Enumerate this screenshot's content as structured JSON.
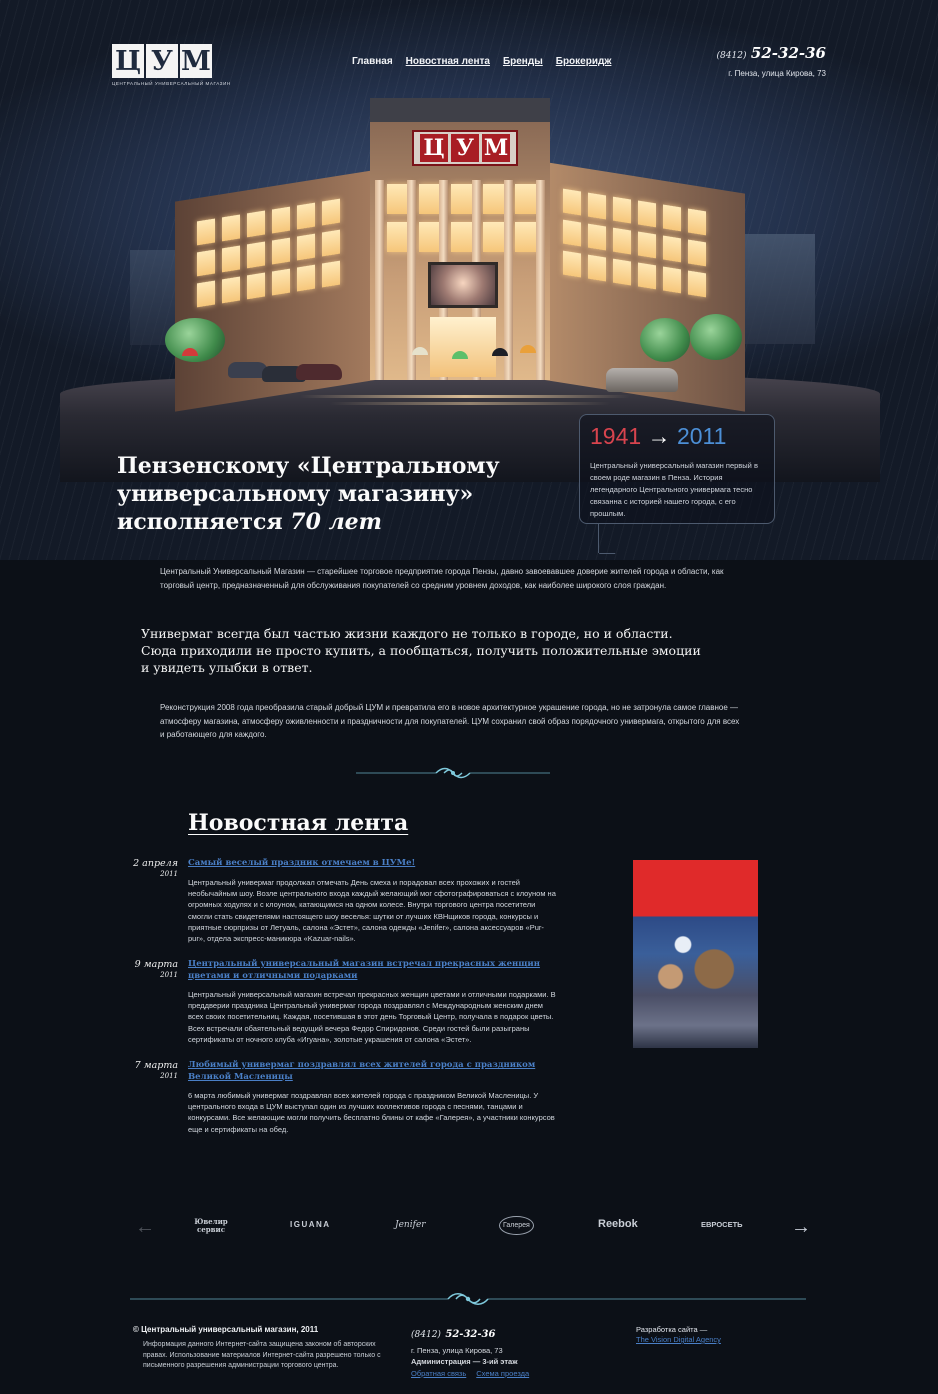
{
  "header": {
    "logo_letters": [
      "Ц",
      "У",
      "М"
    ],
    "logo_subtitle": "ЦЕНТРАЛЬНЫЙ УНИВЕРСАЛЬНЫЙ МАГАЗИН",
    "nav": [
      {
        "label": "Главная",
        "active": true
      },
      {
        "label": "Новостная лента",
        "active": false
      },
      {
        "label": "Бренды",
        "active": false
      },
      {
        "label": "Брокеридж",
        "active": false
      }
    ],
    "phone_code": "(8412)",
    "phone_number": "52-32-36",
    "address": "г. Пенза, улица Кирова, 73"
  },
  "hero": {
    "sign_letters": [
      "Ц",
      "У",
      "М"
    ]
  },
  "intro": {
    "title_text": "Пензенскому «Центральному универсальному магазину» исполняется ",
    "title_age": "70 лет",
    "year_from": "1941",
    "arrow": "→",
    "year_to": "2011",
    "bubble_text": "Центральный универсальный магазин первый в своем роде магазин в Пенза. История легендарного Центрального универмага тесно связанна с историей нашего города, с его прошлым.",
    "paragraph1": "Центральный Универсальный Магазин — старейшее торговое предприятие города Пензы, давно завоевавшее доверие жителей города и области, как торговый центр, предназначенный для обслуживания покупателей со средним уровнем доходов, как наиболее широкого слоя граждан.",
    "quote": "Универмаг всегда был частью жизни каждого не только в городе, но и области. Сюда приходили не просто купить, а пообщаться, получить положительные эмоции и увидеть улыбки в ответ.",
    "paragraph2": "Реконструкция 2008 года преобразила старый добрый ЦУМ и превратила его в новое архитектурное украшение города, но не затронула самое главное — атмосферу магазина, атмосферу оживленности и праздничности для покупателей. ЦУМ сохранил свой образ порядочного универмага, открытого для всех и работающего для каждого."
  },
  "news": {
    "title": "Новостная лента",
    "items": [
      {
        "date": "2 апреля",
        "year": "2011",
        "headline": "Самый веселый праздник отмечаем в ЦУМе!",
        "body": "Центральный универмаг продолжал отмечать День смеха и порадовал всех прохожих и гостей необычайным шоу. Возле центрального входа каждый желающий мог сфотографироваться с клоуном на огромных ходулях и с клоуном, катающимся на одном колесе. Внутри торгового центра посетители смогли стать свидетелями настоящего шоу веселья: шутки от лучших КВНщиков города, конкурсы и приятные сюрпризы от Летуаль, салона «Эстет», салона одежды «Jenifer», салона аксессуаров «Pur-pur», отдела экспресс-маникюра «Kazuar-nails»."
      },
      {
        "date": "9 марта",
        "year": "2011",
        "headline": "Центральный универсальный магазин встречал прекрасных женщин цветами и отличными подарками",
        "body": "Центральный универсальный магазин встречал прекрасных женщин цветами и отличными подарками. В преддверии праздника Центральный универмаг города поздравлял с Международным женским днем всех своих посетительниц. Каждая, посетившая в этот день Торговый Центр, получала в подарок цветы. Всех встречали обаятельный ведущий вечера Федор Спиридонов. Среди гостей были разыграны сертификаты от ночного клуба «Игуана», золотые украшения от салона «Эстет»."
      },
      {
        "date": "7 марта",
        "year": "2011",
        "headline": "Любимый универмаг поздравлял всех жителей города с праздником Великой Масленицы",
        "body": "6 марта любимый универмаг поздравлял всех жителей города с праздником Великой Масленицы. У центрального входа в ЦУМ выступал один из лучших коллективов города с песнями, танцами и конкурсами. Все желающие могли получить бесплатно блины от кафе «Галерея», а участники конкурсов еще и сертификаты на обед."
      }
    ]
  },
  "partners": {
    "prev": "←",
    "next": "→",
    "logos": [
      "Ювелир сервис",
      "IGUANA",
      "Jenifer",
      "Галерея",
      "Reebok",
      "ЕВРОСЕТЬ"
    ]
  },
  "footer": {
    "copyright": "© Центральный универсальный магазин, 2011",
    "legal": "Информация данного Интернет-сайта защищена законом об авторских правах. Использование материалов Интернет-сайта разрешено только с письменного разрешения администрации торгового центра.",
    "phone_code": "(8412)",
    "phone_number": "52-32-36",
    "address": "г. Пенза, улица Кирова, 73",
    "admin": "Администрация — 3-ий этаж",
    "feedback_link": "Обратная связь",
    "map_link": "Схема проезда",
    "dev_label": "Разработка сайта —",
    "dev_link": "The Vision Digital Agency"
  },
  "colors": {
    "background": "#0c1017",
    "link_blue": "#4a7fc6",
    "year_red": "#d8444e",
    "year_blue": "#4c8fd6"
  }
}
